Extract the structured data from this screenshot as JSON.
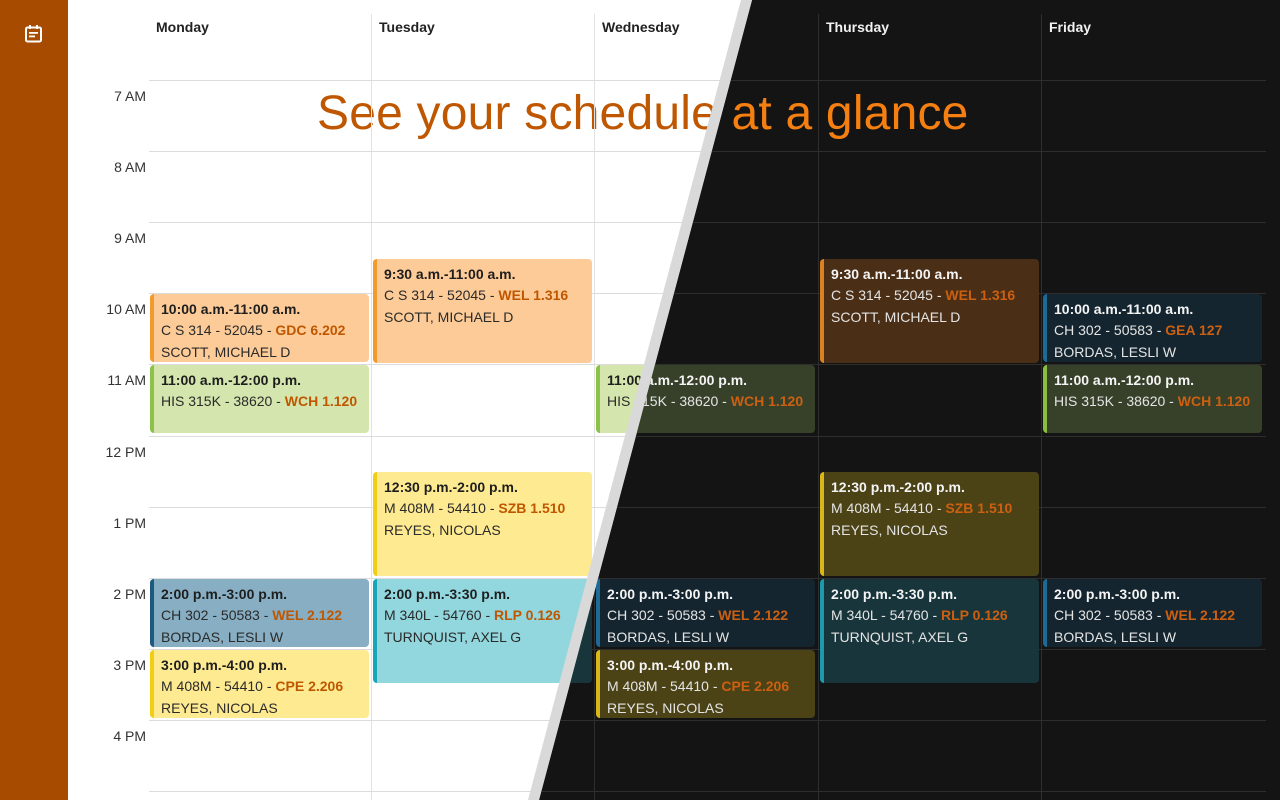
{
  "sidebar": {
    "icon": "calendar-icon",
    "accent_color": "#a64b00"
  },
  "headline": "See your schedule at a glance",
  "days": [
    "Monday",
    "Tuesday",
    "Wednesday",
    "Thursday",
    "Friday"
  ],
  "hours": [
    "7 AM",
    "8 AM",
    "9 AM",
    "10 AM",
    "11 AM",
    "12 PM",
    "1 PM",
    "2 PM",
    "3 PM",
    "4 PM"
  ],
  "themes": {
    "light": {
      "background": "#ffffff",
      "headline_color": "#bf5700"
    },
    "dark": {
      "background": "#141414",
      "headline_color": "#f57f10"
    }
  },
  "course_colors": {
    "CS314": {
      "light_bg": "#fdcb97",
      "light_bar": "#f39a2c",
      "dark_bg": "#4a2f16",
      "dark_bar": "#d9821f"
    },
    "HIS315K": {
      "light_bg": "#d4e6ad",
      "light_bar": "#8cc24a",
      "dark_bg": "#37412a",
      "dark_bar": "#8cbd3f"
    },
    "CH302": {
      "light_bg": "#87aec3",
      "light_bar": "#1c5a80",
      "dark_bg": "#14252f",
      "dark_bar": "#1c6a95"
    },
    "M408M": {
      "light_bg": "#feea91",
      "light_bar": "#f2cd12",
      "dark_bg": "#4b4216",
      "dark_bar": "#d9b61a"
    },
    "M340L": {
      "light_bg": "#92d6de",
      "light_bar": "#17a6b8",
      "dark_bg": "#17353b",
      "dark_bar": "#1a9aac"
    }
  },
  "events": [
    {
      "day": 0,
      "start": 10.0,
      "end": 11.0,
      "course_key": "CS314",
      "time": "10:00 a.m.-11:00 a.m.",
      "course": "C S 314 - 52045 - ",
      "location": "GDC 6.202",
      "instructor": "SCOTT, MICHAEL D"
    },
    {
      "day": 0,
      "start": 11.0,
      "end": 12.0,
      "course_key": "HIS315K",
      "time": "11:00 a.m.-12:00 p.m.",
      "course": "HIS 315K - 38620 - ",
      "location": "WCH 1.120",
      "instructor": ""
    },
    {
      "day": 0,
      "start": 14.0,
      "end": 15.0,
      "course_key": "CH302",
      "time": "2:00 p.m.-3:00 p.m.",
      "course": "CH 302 - 50583 - ",
      "location": "WEL 2.122",
      "instructor": "BORDAS, LESLI W"
    },
    {
      "day": 0,
      "start": 15.0,
      "end": 16.0,
      "course_key": "M408M",
      "time": "3:00 p.m.-4:00 p.m.",
      "course": "M 408M - 54410 - ",
      "location": "CPE 2.206",
      "instructor": "REYES, NICOLAS"
    },
    {
      "day": 1,
      "start": 9.5,
      "end": 11.0,
      "course_key": "CS314",
      "time": "9:30 a.m.-11:00 a.m.",
      "course": "C S 314 - 52045 - ",
      "location": "WEL 1.316",
      "instructor": "SCOTT, MICHAEL D"
    },
    {
      "day": 1,
      "start": 12.5,
      "end": 14.0,
      "course_key": "M408M",
      "time": "12:30 p.m.-2:00 p.m.",
      "course": "M 408M - 54410 - ",
      "location": "SZB 1.510",
      "instructor": "REYES, NICOLAS"
    },
    {
      "day": 1,
      "start": 14.0,
      "end": 15.5,
      "course_key": "M340L",
      "time": "2:00 p.m.-3:30 p.m.",
      "course": "M 340L - 54760 - ",
      "location": "RLP 0.126",
      "instructor": "TURNQUIST, AXEL G"
    },
    {
      "day": 2,
      "start": 11.0,
      "end": 12.0,
      "course_key": "HIS315K",
      "time": "11:00 a.m.-12:00 p.m.",
      "course": "HIS 315K - 38620 - ",
      "location": "WCH 1.120",
      "instructor": ""
    },
    {
      "day": 2,
      "start": 14.0,
      "end": 15.0,
      "course_key": "CH302",
      "time": "2:00 p.m.-3:00 p.m.",
      "course": "CH 302 - 50583 - ",
      "location": "WEL 2.122",
      "instructor": "BORDAS, LESLI W"
    },
    {
      "day": 2,
      "start": 15.0,
      "end": 16.0,
      "course_key": "M408M",
      "time": "3:00 p.m.-4:00 p.m.",
      "course": "M 408M - 54410 - ",
      "location": "CPE 2.206",
      "instructor": "REYES, NICOLAS"
    },
    {
      "day": 3,
      "start": 9.5,
      "end": 11.0,
      "course_key": "CS314",
      "time": "9:30 a.m.-11:00 a.m.",
      "course": "C S 314 - 52045 - ",
      "location": "WEL 1.316",
      "instructor": "SCOTT, MICHAEL D"
    },
    {
      "day": 3,
      "start": 12.5,
      "end": 14.0,
      "course_key": "M408M",
      "time": "12:30 p.m.-2:00 p.m.",
      "course": "M 408M - 54410 - ",
      "location": "SZB 1.510",
      "instructor": "REYES, NICOLAS"
    },
    {
      "day": 3,
      "start": 14.0,
      "end": 15.5,
      "course_key": "M340L",
      "time": "2:00 p.m.-3:30 p.m.",
      "course": "M 340L - 54760 - ",
      "location": "RLP 0.126",
      "instructor": "TURNQUIST, AXEL G"
    },
    {
      "day": 4,
      "start": 10.0,
      "end": 11.0,
      "course_key": "CH302",
      "time": "10:00 a.m.-11:00 a.m.",
      "course": "CH 302 - 50583 - ",
      "location": "GEA 127",
      "instructor": "BORDAS, LESLI W"
    },
    {
      "day": 4,
      "start": 11.0,
      "end": 12.0,
      "course_key": "HIS315K",
      "time": "11:00 a.m.-12:00 p.m.",
      "course": "HIS 315K - 38620 - ",
      "location": "WCH 1.120",
      "instructor": ""
    },
    {
      "day": 4,
      "start": 14.0,
      "end": 15.0,
      "course_key": "CH302",
      "time": "2:00 p.m.-3:00 p.m.",
      "course": "CH 302 - 50583 - ",
      "location": "WEL 2.122",
      "instructor": "BORDAS, LESLI W"
    }
  ]
}
